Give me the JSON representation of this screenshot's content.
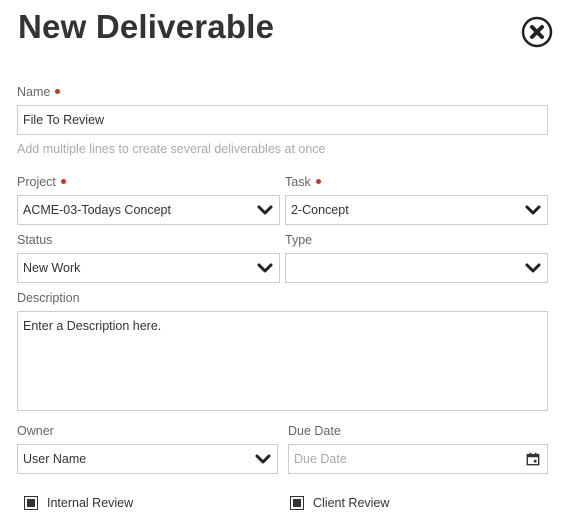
{
  "dialog": {
    "title": "New Deliverable"
  },
  "icons": {
    "close": "close-circle-icon",
    "chevron": "chevron-down-icon",
    "calendar": "calendar-icon"
  },
  "colors": {
    "required_dot": "#c0392b",
    "border": "#cccccc",
    "hint": "#aaaaaa"
  },
  "form": {
    "name": {
      "label": "Name",
      "value": "File To Review",
      "hint": "Add multiple lines to create several deliverables at once"
    },
    "project": {
      "label": "Project",
      "value": "ACME-03-Todays Concept"
    },
    "task": {
      "label": "Task",
      "value": "2-Concept"
    },
    "status": {
      "label": "Status",
      "value": "New Work"
    },
    "type": {
      "label": "Type",
      "value": ""
    },
    "description": {
      "label": "Description",
      "value": "Enter a Description here."
    },
    "owner": {
      "label": "Owner",
      "value": "User Name"
    },
    "due_date": {
      "label": "Due Date",
      "placeholder": "Due Date"
    },
    "internal_review": {
      "label": "Internal Review",
      "checked": true
    },
    "client_review": {
      "label": "Client Review",
      "checked": true
    }
  }
}
